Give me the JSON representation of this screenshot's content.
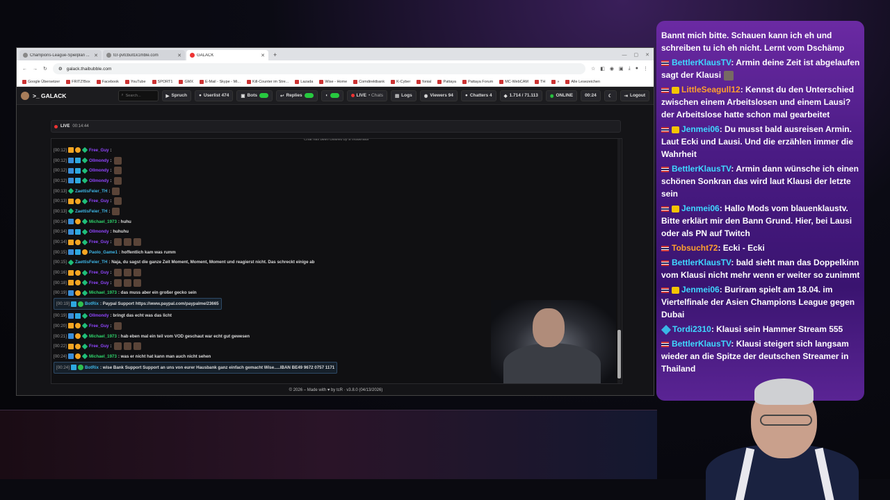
{
  "browser": {
    "tabs": [
      {
        "title": "Champions-League-Spielplan ...",
        "active": false
      },
      {
        "title": "tcr-pvtcbull1k1mble.com",
        "active": false
      },
      {
        "title": "GALACK",
        "active": true
      }
    ],
    "new_tab": "+",
    "window_controls": [
      "—",
      "▢",
      "✕"
    ],
    "url": "galack.thaibubble.com",
    "bookmarks": [
      "Google Übersetzer",
      "FRITZ!Box",
      "Facebook",
      "YouTube",
      "SPORT1",
      "GMX",
      "E-Mail - Skype - Mi...",
      "Kill-Counter im Stre...",
      "Lazada",
      "Wise - Home",
      "Comdirektbank",
      "K-Cyber",
      "fonial",
      "Pattaya",
      "Pattaya Forum",
      "MC-WebCAM",
      "TH",
      "»",
      "Alle Lesezeichen"
    ]
  },
  "app": {
    "brand": ">_ GALACK",
    "search_placeholder": "Search...",
    "nav": {
      "spruch": "Spruch",
      "userlist": "Userlist 474",
      "bots": "Bots",
      "replies": "Replies",
      "live": "LIVE",
      "chats": "• Chats",
      "logs": "Logs",
      "viewers": "Viewers 94",
      "chatters": "Chatters 4",
      "counter": "1.714 / 71.113",
      "online": "ONLINE",
      "time": "00:24",
      "logout": "Logout"
    },
    "livebar": {
      "label": "LIVE",
      "time": "00:14:44"
    },
    "cleared_notice": "Chat has been cleared by a moderator",
    "footer": "© 2026 – Made with ♥ by tcR · v3.8.0 (04/13/2026)"
  },
  "chat": [
    {
      "ts": "[00:12]",
      "badges": [
        "vip",
        "sub",
        "star"
      ],
      "user": "Free_Guy",
      "color": "#9146ff",
      "text": ":",
      "emotes": 0,
      "bot": false
    },
    {
      "ts": "[00:12]",
      "badges": [
        "mod",
        "bot",
        "star"
      ],
      "user": "Ollmondy",
      "color": "#9146ff",
      "text": ":",
      "emotes": 1,
      "bot": false
    },
    {
      "ts": "[00:12]",
      "badges": [
        "mod",
        "bot",
        "star"
      ],
      "user": "Ollmondy",
      "color": "#9146ff",
      "text": ":",
      "emotes": 1,
      "bot": false
    },
    {
      "ts": "[00:12]",
      "badges": [
        "mod",
        "bot",
        "star"
      ],
      "user": "Ollmondy",
      "color": "#9146ff",
      "text": ":",
      "emotes": 1,
      "bot": false
    },
    {
      "ts": "[00:13]",
      "badges": [
        "star"
      ],
      "user": "ZaettisFeier_TH",
      "color": "#3fb6e6",
      "text": ":",
      "emotes": 1,
      "bot": false
    },
    {
      "ts": "[00:13]",
      "badges": [
        "vip",
        "sub",
        "star"
      ],
      "user": "Free_Guy",
      "color": "#9146ff",
      "text": ":",
      "emotes": 1,
      "bot": false
    },
    {
      "ts": "[00:13]",
      "badges": [
        "star"
      ],
      "user": "ZaettisFeier_TH",
      "color": "#3fb6e6",
      "text": ":",
      "emotes": 1,
      "bot": false
    },
    {
      "ts": "[00:14]",
      "badges": [
        "mod",
        "sub",
        "star"
      ],
      "user": "Michael_1973",
      "color": "#2fd36b",
      "text": ": huhu",
      "emotes": 0,
      "bot": false
    },
    {
      "ts": "[00:14]",
      "badges": [
        "mod",
        "bot",
        "star"
      ],
      "user": "Ollmondy",
      "color": "#9146ff",
      "text": ": huhuhu",
      "emotes": 0,
      "bot": false
    },
    {
      "ts": "[00:14]",
      "badges": [
        "vip",
        "sub",
        "star"
      ],
      "user": "Free_Guy",
      "color": "#9146ff",
      "text": ":",
      "emotes": 3,
      "bot": false
    },
    {
      "ts": "[00:15]",
      "badges": [
        "mod",
        "bot",
        "sub"
      ],
      "user": "Paolo_Game1",
      "color": "#3fb6e6",
      "text": ": hoffentlich kam was rumm",
      "emotes": 0,
      "bot": false
    },
    {
      "ts": "[00:15]",
      "badges": [
        "star"
      ],
      "user": "ZaettisFeier_TH",
      "color": "#3fb6e6",
      "text": ": Naja, du sagst die ganze Zeit Moment, Moment, Moment und reagierst nicht. Das schreckt einige ab",
      "emotes": 0,
      "bot": false
    },
    {
      "ts": "[00:16]",
      "badges": [
        "vip",
        "sub",
        "star"
      ],
      "user": "Free_Guy",
      "color": "#9146ff",
      "text": ":",
      "emotes": 3,
      "bot": false
    },
    {
      "ts": "[00:18]",
      "badges": [
        "vip",
        "sub",
        "star"
      ],
      "user": "Free_Guy",
      "color": "#9146ff",
      "text": ":",
      "emotes": 3,
      "bot": false
    },
    {
      "ts": "[00:19]",
      "badges": [
        "mod",
        "sub",
        "star"
      ],
      "user": "Michael_1973",
      "color": "#2fd36b",
      "text": ": das muss aber ein großer gecko sein",
      "emotes": 0,
      "bot": false
    },
    {
      "ts": "[00:19]",
      "badges": [
        "bot",
        "ok"
      ],
      "user": "BotRix",
      "color": "#3fb6e6",
      "text": ": Paypal Support https://www.paypal.com/paypalme/23665",
      "emotes": 0,
      "bot": true
    },
    {
      "ts": "[00:19]",
      "badges": [
        "mod",
        "bot",
        "star"
      ],
      "user": "Ollmondy",
      "color": "#9146ff",
      "text": ": bringt das echt was das licht",
      "emotes": 0,
      "bot": false
    },
    {
      "ts": "[00:20]",
      "badges": [
        "vip",
        "sub",
        "star"
      ],
      "user": "Free_Guy",
      "color": "#9146ff",
      "text": ":",
      "emotes": 1,
      "bot": false
    },
    {
      "ts": "[00:21]",
      "badges": [
        "mod",
        "sub",
        "star"
      ],
      "user": "Michael_1973",
      "color": "#2fd36b",
      "text": ": hab eben mal ein teil vom VOD geschaut war echt gut gewesen",
      "emotes": 0,
      "bot": false
    },
    {
      "ts": "[00:22]",
      "badges": [
        "vip",
        "sub",
        "star"
      ],
      "user": "Free_Guy",
      "color": "#9146ff",
      "text": ":",
      "emotes": 3,
      "bot": false
    },
    {
      "ts": "[00:24]",
      "badges": [
        "mod",
        "sub",
        "star"
      ],
      "user": "Michael_1973",
      "color": "#2fd36b",
      "text": ": was er nicht hat kann man auch nicht sehen",
      "emotes": 0,
      "bot": false
    },
    {
      "ts": "[00:24]",
      "badges": [
        "bot",
        "ok"
      ],
      "user": "BotRix",
      "color": "#3fb6e6",
      "text": ": wise Bank Support Support an uns von eurer Hausbank ganz einfach gemacht Wise.....IBAN BE49 9672 0757 1171",
      "emotes": 0,
      "bot": true
    }
  ],
  "overlay": [
    {
      "badge": "",
      "user": "",
      "color": "#ffffff",
      "text": "Bannt mich bitte. Schauen kann ich eh und schreiben tu ich eh nicht. Lernt vom Dschämp",
      "emote": false
    },
    {
      "badge": "flag",
      "user": "BettlerKlausTV",
      "color": "#3fd8ff",
      "text": ": Armin deine Zeit ist abgelaufen sagt der Klausi",
      "emote": true
    },
    {
      "badge": "flag-crown",
      "user": "LittleSeagull12",
      "color": "#ff9f2e",
      "text": ": Kennst du den Unterschied zwischen einem Arbeitslosen und einem Lausi? der Arbeitslose hatte schon mal gearbeitet",
      "emote": false
    },
    {
      "badge": "flag-crown",
      "user": "Jenmei06",
      "color": "#3fd8ff",
      "text": ": Du musst bald ausreisen Armin. Laut Ecki und Lausi. Und die erzählen immer die Wahrheit",
      "emote": false
    },
    {
      "badge": "flag",
      "user": "BettlerKlausTV",
      "color": "#3fd8ff",
      "text": ": Armin dann wünsche ich einen schönen Sonkran das wird laut Klausi der letzte sein",
      "emote": false
    },
    {
      "badge": "flag-crown",
      "user": "Jenmei06",
      "color": "#3fd8ff",
      "text": ": Hallo Mods vom blauenklaustv. Bitte erklärt mir den Bann Grund. Hier, bei Lausi oder als PN auf Twitch",
      "emote": false
    },
    {
      "badge": "flag",
      "user": "Tobsucht72",
      "color": "#ff9f2e",
      "text": ": Ecki - Ecki",
      "emote": false
    },
    {
      "badge": "flag",
      "user": "BettlerKlausTV",
      "color": "#3fd8ff",
      "text": ": bald sieht man das Doppelkinn vom Klausi nicht mehr wenn er weiter so zunimmt",
      "emote": false
    },
    {
      "badge": "flag-crown",
      "user": "Jenmei06",
      "color": "#3fd8ff",
      "text": ": Buriram spielt am 18.04. im Viertelfinale der Asien Champions League gegen Dubai",
      "emote": false
    },
    {
      "badge": "gem",
      "user": "Tordi2310",
      "color": "#3fd8ff",
      "text": ": Klausi sein Hammer Stream 555",
      "emote": false
    },
    {
      "badge": "flag",
      "user": "BettlerKlausTV",
      "color": "#3fd8ff",
      "text": ": Klausi steigert sich langsam wieder an die Spitze der deutschen Streamer in Thailand",
      "emote": false
    }
  ]
}
